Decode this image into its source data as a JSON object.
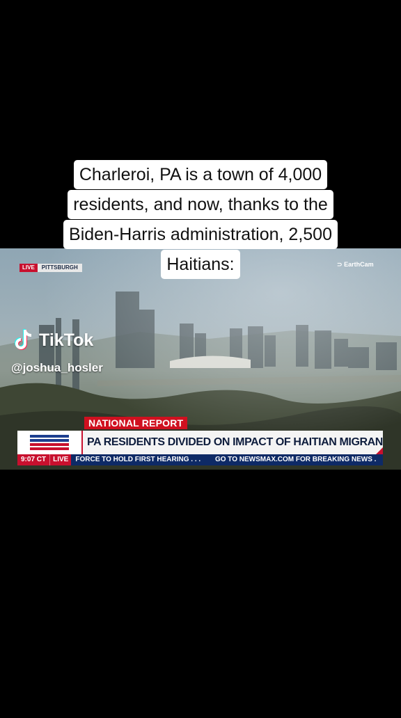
{
  "caption": {
    "lines": [
      "Charleroi, PA is a town of 4,000",
      "residents, and now, thanks to the",
      "Biden-Harris administration, 2,500",
      "Haitians:"
    ]
  },
  "video": {
    "live_label": "LIVE",
    "location_label": "PITTSBURGH",
    "camera_credit": "EarthCam",
    "segment_label": "NATIONAL REPORT",
    "headline": "PA RESIDENTS DIVIDED ON IMPACT OF HAITIAN MIGRANT INFLUX",
    "ticker": {
      "time": "9:07 CT",
      "live": "LIVE",
      "items": [
        "FORCE TO HOLD FIRST HEARING . . .",
        "GO TO NEWSMAX.COM FOR BREAKING NEWS ."
      ]
    }
  },
  "watermark": {
    "brand": "TikTok",
    "handle": "@joshua_hosler"
  },
  "colors": {
    "accent_red": "#c8102e",
    "navy": "#0e2a66"
  }
}
